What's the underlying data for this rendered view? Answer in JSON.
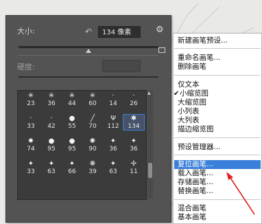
{
  "panel": {
    "size_label": "大小:",
    "size_value": "134 像素",
    "hardness_label": "硬度:"
  },
  "brush_grid": {
    "rows": [
      [
        "23",
        "36",
        "44",
        "60",
        "14",
        "26"
      ],
      [
        "33",
        "42",
        "55",
        "70",
        "112",
        "134"
      ],
      [
        "74",
        "95",
        "95",
        "90",
        "36",
        "36"
      ],
      [
        "33",
        "63",
        "66",
        "39",
        "63",
        "11"
      ]
    ],
    "selected": "134"
  },
  "menu": {
    "items": [
      "新建画笔预设...",
      "重命名画笔...",
      "删除画笔",
      "仅文本",
      "小缩览图",
      "大缩览图",
      "小列表",
      "大列表",
      "描边缩览图",
      "预设管理器...",
      "复位画笔...",
      "载入画笔...",
      "存储画笔...",
      "替换画笔...",
      "混合画笔",
      "基本画笔"
    ],
    "checked_item": "小缩览图",
    "highlighted_item": "复位画笔..."
  },
  "colors": {
    "panel_bg": "#535353",
    "highlight": "#3a7fd9",
    "arrow": "#e02020"
  }
}
